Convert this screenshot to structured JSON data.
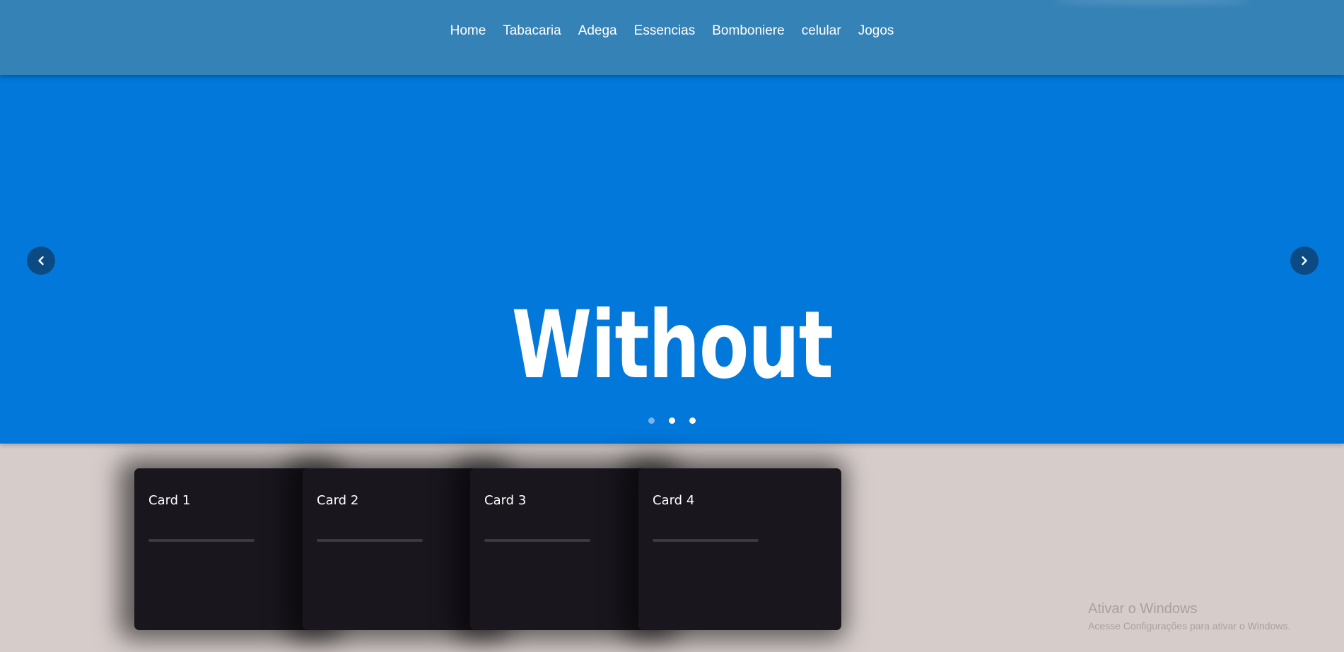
{
  "nav": {
    "items": [
      {
        "label": "Home"
      },
      {
        "label": "Tabacaria"
      },
      {
        "label": "Adega"
      },
      {
        "label": "Essencias"
      },
      {
        "label": "Bomboniere"
      },
      {
        "label": "celular"
      },
      {
        "label": "Jogos"
      }
    ]
  },
  "hero": {
    "word": "Without",
    "background_color": "#0278db",
    "prev_icon": "chevron-left-icon",
    "next_icon": "chevron-right-icon",
    "slide_count": 3,
    "active_slide_dim": 1
  },
  "cards": [
    {
      "title": "Card 1"
    },
    {
      "title": "Card 2"
    },
    {
      "title": "Card 3"
    },
    {
      "title": "Card 4"
    }
  ],
  "watermark": {
    "title": "Ativar o Windows",
    "subtitle": "Acesse Configurações para ativar o Windows."
  },
  "colors": {
    "header": "#3582b6",
    "hero": "#0278db",
    "page_background": "#d6cdcb",
    "card": "#19161e",
    "arrow": "#0c4a84"
  }
}
